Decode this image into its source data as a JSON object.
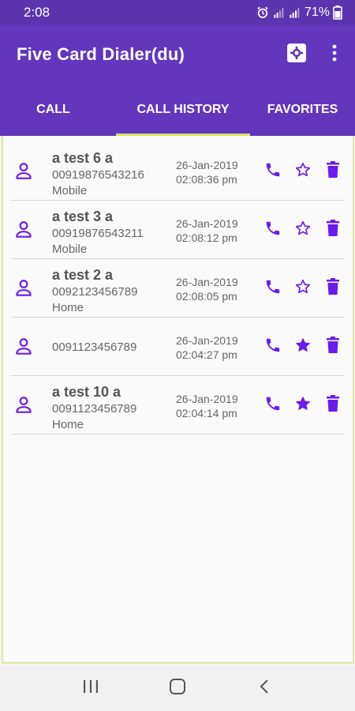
{
  "status_bar": {
    "time": "2:08",
    "battery": "71%",
    "icons": [
      "alarm-icon",
      "signal-icon",
      "signal-icon",
      "battery-icon"
    ]
  },
  "app_bar": {
    "title": "Five Card Dialer(du)",
    "actions": [
      "settings-icon",
      "more-vert-icon"
    ]
  },
  "tabs": [
    {
      "label": "CALL",
      "active": false
    },
    {
      "label": "CALL HISTORY",
      "active": true
    },
    {
      "label": "FAVORITES",
      "active": false
    }
  ],
  "call_history": [
    {
      "name": "a test 6 a",
      "number": "00919876543216",
      "type": "Mobile",
      "date": "26-Jan-2019",
      "time": "02:08:36 pm",
      "favorite": false
    },
    {
      "name": "a test 3 a",
      "number": "00919876543211",
      "type": "Mobile",
      "date": "26-Jan-2019",
      "time": "02:08:12 pm",
      "favorite": false
    },
    {
      "name": "a test 2 a",
      "number": "0092123456789",
      "type": "Home",
      "date": "26-Jan-2019",
      "time": "02:08:05 pm",
      "favorite": false
    },
    {
      "name": "",
      "number": "0091123456789",
      "type": "",
      "date": "26-Jan-2019",
      "time": "02:04:27 pm",
      "favorite": true
    },
    {
      "name": "a test 10 a",
      "number": "0091123456789",
      "type": "Home",
      "date": "26-Jan-2019",
      "time": "02:04:14 pm",
      "favorite": true
    }
  ],
  "colors": {
    "primary": "#6236bd",
    "status_bar": "#5b34b0",
    "accent": "#6a1bea",
    "tab_indicator": "#d8e26b"
  },
  "nav_bar": [
    "recents-icon",
    "home-icon",
    "back-icon"
  ]
}
